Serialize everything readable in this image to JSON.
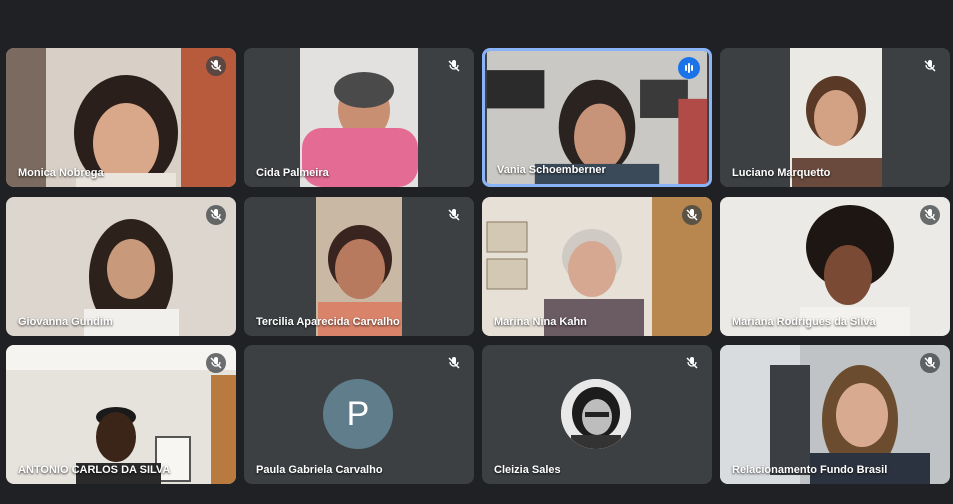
{
  "participants": [
    {
      "name": "Monica Nobrega",
      "muted": true
    },
    {
      "name": "Cida Palmeira",
      "muted": true
    },
    {
      "name": "Vania Schoemberner",
      "muted": false,
      "speaking": true
    },
    {
      "name": "Luciano Marquetto",
      "muted": true
    },
    {
      "name": "Giovanna Gundim",
      "muted": true
    },
    {
      "name": "Tercilia Aparecida Carvalho",
      "muted": true
    },
    {
      "name": "Marina Nina Kahn",
      "muted": true
    },
    {
      "name": "Mariana Rodrigues da Silva",
      "muted": true
    },
    {
      "name": "ANTONIO CARLOS DA SILVA",
      "muted": true
    },
    {
      "name": "Paula Gabriela Carvalho",
      "muted": true,
      "avatar_letter": "P"
    },
    {
      "name": "Cleizia Sales",
      "muted": true
    },
    {
      "name": "Relacionamento Fundo Brasil",
      "muted": true
    }
  ],
  "colors": {
    "background": "#202124",
    "tile": "#3c4043",
    "active_border": "#8ab4f8",
    "speaking": "#1a73e8",
    "avatar_letter_bg": "#607d8b"
  },
  "icons": {
    "muted": "mic-off-icon",
    "speaking": "audio-level-icon"
  }
}
